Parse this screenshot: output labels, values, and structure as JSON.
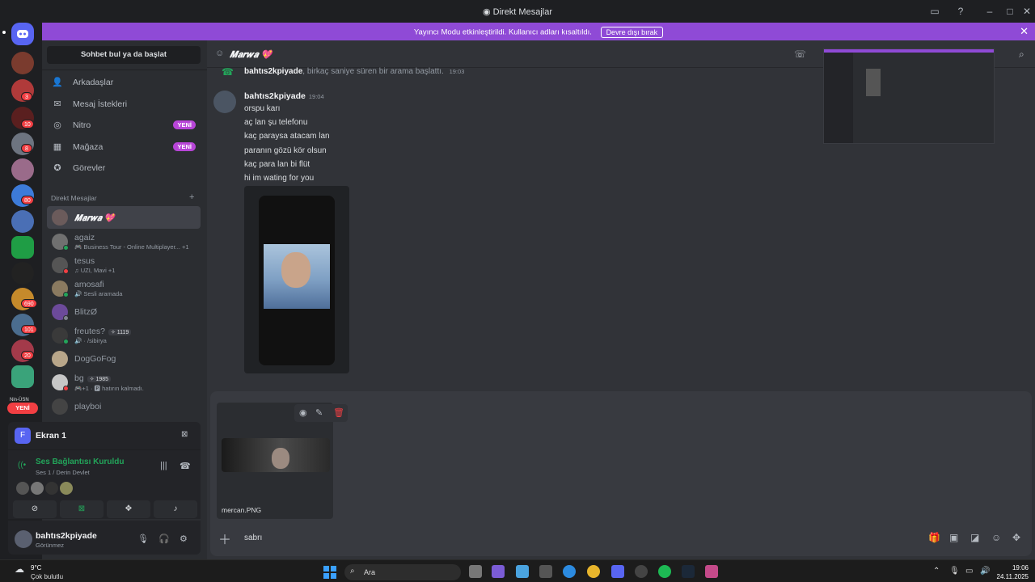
{
  "window": {
    "title": "Direkt Mesajlar"
  },
  "banner": {
    "text": "Yayıncı Modu etkinleştirildi. Kullanıcı adları kısaltıldı.",
    "button": "Devre dışı bırak",
    "color": "#8f4ad6"
  },
  "servers": [
    {
      "badge": ""
    },
    {
      "badge": "3"
    },
    {
      "badge": "10"
    },
    {
      "badge": "8"
    },
    {
      "badge": ""
    },
    {
      "badge": "80"
    },
    {
      "badge": ""
    },
    {
      "badge": ""
    },
    {
      "badge": ""
    },
    {
      "badge": "690"
    },
    {
      "badge": "101"
    },
    {
      "badge": "20"
    },
    {
      "badge": ""
    }
  ],
  "rail_new": "YENİ",
  "rail_label": "Nin-ÜSN",
  "sidebar": {
    "search": "Sohbet bul ya da başlat",
    "nav": [
      {
        "label": "Arkadaşlar",
        "icon": "friends-icon",
        "badge": ""
      },
      {
        "label": "Mesaj İstekleri",
        "icon": "mail-icon",
        "badge": ""
      },
      {
        "label": "Nitro",
        "icon": "nitro-icon",
        "badge": "YENİ"
      },
      {
        "label": "Mağaza",
        "icon": "shop-icon",
        "badge": "YENİ"
      },
      {
        "label": "Görevler",
        "icon": "quests-icon",
        "badge": ""
      }
    ],
    "dm_header": "Direkt Mesajlar",
    "dms": [
      {
        "name": "𝑴𝒂𝒓𝒘𝒂 💖",
        "sub": "",
        "tag": ""
      },
      {
        "name": "agaiz",
        "sub": "🎮 Business Tour - Online Multiplayer... +1",
        "tag": ""
      },
      {
        "name": "tesus",
        "sub": "♫ UZI, Mavi +1",
        "tag": ""
      },
      {
        "name": "amosafi",
        "sub": "🔊 Sesli aramada",
        "tag": ""
      },
      {
        "name": "BlitzØ",
        "sub": "",
        "tag": ""
      },
      {
        "name": "freutes?",
        "sub": "🔊 · /sibirya",
        "tag": "✧ 1119"
      },
      {
        "name": "DogGoFog",
        "sub": "",
        "tag": ""
      },
      {
        "name": "bg",
        "sub": "🎮+1 · 🅿 hatırın kalmadı.",
        "tag": "✧ 1985"
      },
      {
        "name": "playboi",
        "sub": "",
        "tag": ""
      }
    ]
  },
  "voice_panel": {
    "title": "Ekran 1",
    "status": "Ses Bağlantısı Kuruldu",
    "channel": "Ses 1 / Derin Devlet",
    "status_color": "#23a55a"
  },
  "user_panel": {
    "name": "bahtıs2kpiyade",
    "status": "Görünmez"
  },
  "chat": {
    "header": "𝑴𝒂𝒓𝒘𝒂 💖",
    "system_author": "bahtıs2kpiyade",
    "system_text": ", birkaç saniye süren bir arama başlattı.",
    "system_time": "19:03",
    "author": "bahtıs2kpiyade",
    "time": "19:04",
    "lines": [
      "orspu karı",
      "aç lan şu telefonu",
      "kaç paraysa atacam lan",
      "paranın gözü kör olsun",
      "kaç para lan bi flüt",
      "hi im wating for you"
    ]
  },
  "composer": {
    "attachment_name": "mercan.PNG",
    "text": "sabrı"
  },
  "taskbar": {
    "temp": "9°C",
    "weather": "Çok bulutlu",
    "search": "Ara",
    "time": "19:06",
    "date": "24.11.2025"
  }
}
